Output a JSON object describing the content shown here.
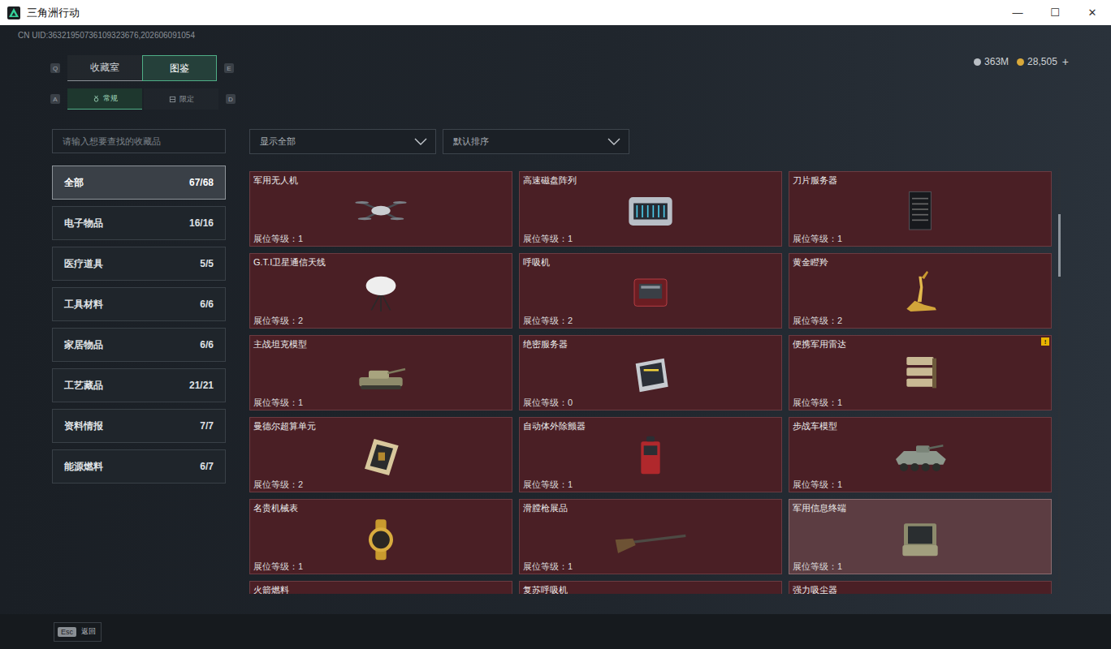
{
  "window": {
    "title": "三角洲行动",
    "controls": [
      "—",
      "☐",
      "✕"
    ]
  },
  "uid": "CN UID:36321950736109323676,202606091054",
  "tabs": {
    "prev_key": "Q",
    "next_key": "E",
    "items": [
      {
        "label": "收藏室",
        "selected": false
      },
      {
        "label": "图鉴",
        "selected": true
      }
    ]
  },
  "subtabs": {
    "prev_key": "A",
    "next_key": "D",
    "items": [
      {
        "label": "常规",
        "selected": true
      },
      {
        "label": "限定",
        "selected": false
      }
    ]
  },
  "currency": [
    {
      "amount": "363M",
      "color": "#b9bec4"
    },
    {
      "amount": "28,505",
      "color": "#d9a93a"
    }
  ],
  "add_button": "+",
  "search": {
    "placeholder": "请输入想要查找的收藏品"
  },
  "filters": [
    {
      "label": "显示全部"
    },
    {
      "label": "默认排序"
    }
  ],
  "categories": [
    {
      "label": "全部",
      "count": "67/68",
      "selected": true
    },
    {
      "label": "电子物品",
      "count": "16/16",
      "selected": false
    },
    {
      "label": "医疗道具",
      "count": "5/5",
      "selected": false
    },
    {
      "label": "工具材料",
      "count": "6/6",
      "selected": false
    },
    {
      "label": "家居物品",
      "count": "6/6",
      "selected": false
    },
    {
      "label": "工艺藏品",
      "count": "21/21",
      "selected": false
    },
    {
      "label": "资料情报",
      "count": "7/7",
      "selected": false
    },
    {
      "label": "能源燃料",
      "count": "6/7",
      "selected": false
    }
  ],
  "grid": {
    "level_label": "展位等级：",
    "items": [
      {
        "name": "军用无人机",
        "level": "1",
        "highlighted": false,
        "badge": null
      },
      {
        "name": "高速磁盘阵列",
        "level": "1",
        "highlighted": false,
        "badge": null
      },
      {
        "name": "刀片服务器",
        "level": "1",
        "highlighted": false,
        "badge": null
      },
      {
        "name": "G.T.I卫星通信天线",
        "level": "2",
        "highlighted": false,
        "badge": null
      },
      {
        "name": "呼吸机",
        "level": "2",
        "highlighted": false,
        "badge": null
      },
      {
        "name": "黄金瞪羚",
        "level": "2",
        "highlighted": false,
        "badge": null
      },
      {
        "name": "主战坦克模型",
        "level": "1",
        "highlighted": false,
        "badge": null
      },
      {
        "name": "绝密服务器",
        "level": "0",
        "highlighted": false,
        "badge": null
      },
      {
        "name": "便携军用雷达",
        "level": "1",
        "highlighted": false,
        "badge": "!"
      },
      {
        "name": "曼德尔超算单元",
        "level": "2",
        "highlighted": false,
        "badge": null
      },
      {
        "name": "自动体外除颤器",
        "level": "1",
        "highlighted": false,
        "badge": null
      },
      {
        "name": "步战车模型",
        "level": "1",
        "highlighted": false,
        "badge": null
      },
      {
        "name": "名贵机械表",
        "level": "1",
        "highlighted": false,
        "badge": null
      },
      {
        "name": "滑膛枪展品",
        "level": "1",
        "highlighted": false,
        "badge": null
      },
      {
        "name": "军用信息终端",
        "level": "1",
        "highlighted": true,
        "badge": null
      },
      {
        "name": "火箭燃料",
        "level": null,
        "highlighted": false,
        "badge": null
      },
      {
        "name": "复苏呼吸机",
        "level": null,
        "highlighted": false,
        "badge": null
      },
      {
        "name": "强力吸尘器",
        "level": null,
        "highlighted": false,
        "badge": null
      }
    ]
  },
  "scrollbar": {
    "offset": 0.11,
    "size": 0.15
  },
  "footer": {
    "key": "Esc",
    "label": "返回"
  }
}
